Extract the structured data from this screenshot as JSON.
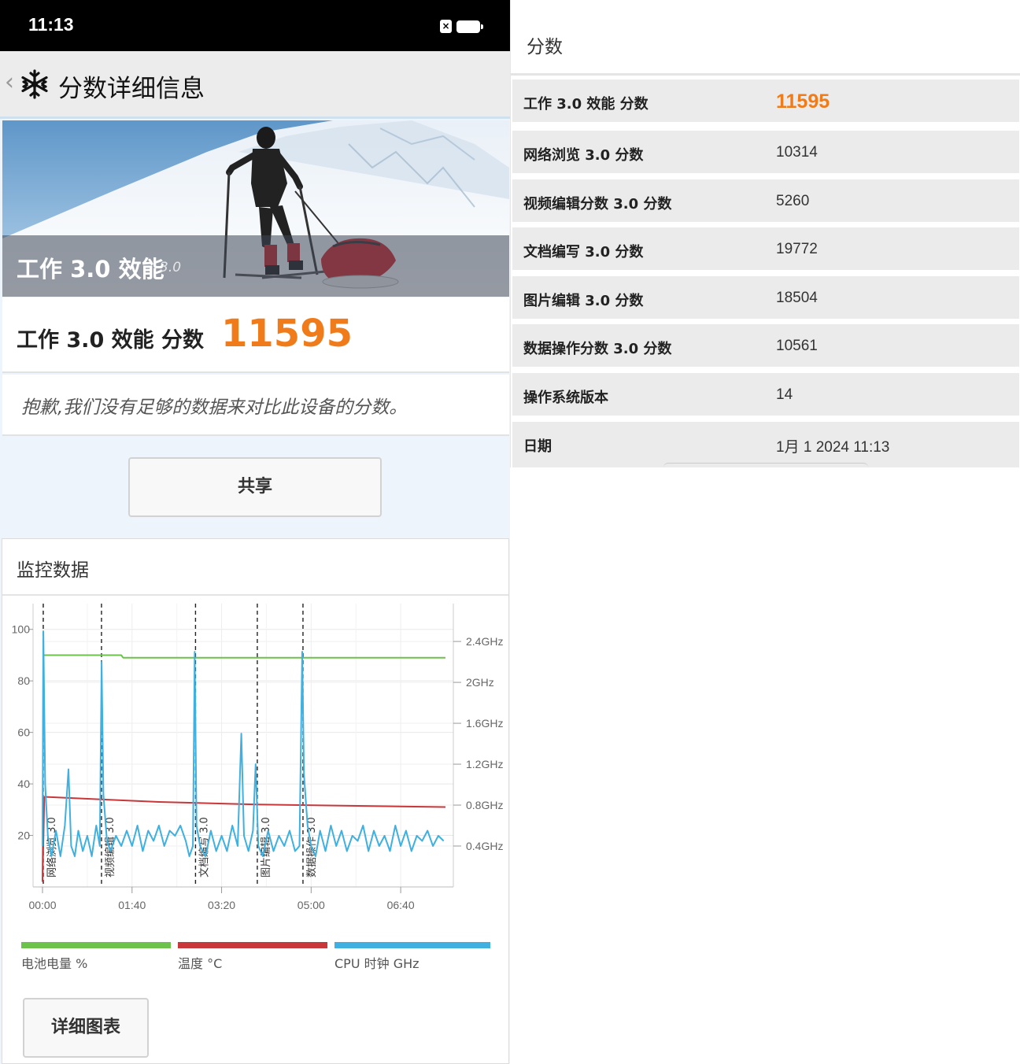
{
  "status_bar": {
    "time": "11:13",
    "sim_icon": "sim-x-icon",
    "battery_icon": "battery-icon"
  },
  "header": {
    "back_icon": "chevron-left-icon",
    "logo_icon": "snowflake-logo-icon",
    "title": "分数详细信息"
  },
  "banner": {
    "title": "工作 3.0 效能",
    "version": "3.0"
  },
  "score": {
    "label": "工作 3.0 效能 分数",
    "value": "11595",
    "accent_color": "#f07b1a"
  },
  "notice": "抱歉,我们没有足够的数据来对比此设备的分数。",
  "share_button": "共享",
  "monitor": {
    "title": "监控数据",
    "detail_button": "详细图表",
    "legend": [
      {
        "label": "电池电量 %",
        "color": "#6cc24a"
      },
      {
        "label": "温度 °C",
        "color": "#c8373a"
      },
      {
        "label": "CPU 时钟 GHz",
        "color": "#3fb0e0"
      }
    ]
  },
  "chart_data": {
    "type": "line",
    "x_tick_labels": [
      "00:00",
      "01:40",
      "03:20",
      "05:00",
      "06:40"
    ],
    "left_axis": {
      "ticks": [
        20,
        40,
        60,
        80,
        100
      ],
      "ylim": [
        0,
        110
      ]
    },
    "right_axis": {
      "ticks": [
        "0.4GHz",
        "0.8GHz",
        "1.2GHz",
        "1.6GHz",
        "2GHz",
        "2.4GHz"
      ],
      "ylim": [
        0,
        2.77
      ]
    },
    "xlim_seconds": [
      0,
      450
    ],
    "segment_markers": [
      {
        "label": "网络浏览 3.0",
        "t": 0
      },
      {
        "label": "视频编辑 3.0",
        "t": 65
      },
      {
        "label": "文档编写 3.0",
        "t": 170
      },
      {
        "label": "图片编辑 3.0",
        "t": 239
      },
      {
        "label": "数据操作 3.0",
        "t": 290
      }
    ],
    "series": [
      {
        "name": "电池电量 %",
        "axis": "left",
        "color": "#6cc24a",
        "points": [
          [
            0,
            2
          ],
          [
            1,
            90
          ],
          [
            88,
            90
          ],
          [
            90,
            89
          ],
          [
            450,
            89
          ]
        ]
      },
      {
        "name": "温度 °C",
        "axis": "left",
        "color": "#c8373a",
        "points": [
          [
            0,
            2
          ],
          [
            2,
            35
          ],
          [
            65,
            34
          ],
          [
            130,
            33
          ],
          [
            240,
            32
          ],
          [
            450,
            31
          ]
        ]
      },
      {
        "name": "CPU 时钟 GHz",
        "axis": "right",
        "color": "#3fb0e0",
        "points": [
          [
            0,
            0.4
          ],
          [
            1,
            2.5
          ],
          [
            3,
            1.0
          ],
          [
            6,
            0.5
          ],
          [
            10,
            0.3
          ],
          [
            15,
            0.55
          ],
          [
            20,
            0.3
          ],
          [
            25,
            0.6
          ],
          [
            29,
            1.15
          ],
          [
            32,
            0.4
          ],
          [
            36,
            0.3
          ],
          [
            40,
            0.55
          ],
          [
            45,
            0.35
          ],
          [
            50,
            0.5
          ],
          [
            55,
            0.3
          ],
          [
            60,
            0.6
          ],
          [
            64,
            0.4
          ],
          [
            66,
            2.2
          ],
          [
            68,
            0.9
          ],
          [
            72,
            0.45
          ],
          [
            76,
            0.35
          ],
          [
            82,
            0.5
          ],
          [
            88,
            0.4
          ],
          [
            94,
            0.55
          ],
          [
            100,
            0.4
          ],
          [
            106,
            0.6
          ],
          [
            112,
            0.35
          ],
          [
            118,
            0.55
          ],
          [
            124,
            0.45
          ],
          [
            130,
            0.6
          ],
          [
            136,
            0.4
          ],
          [
            142,
            0.55
          ],
          [
            148,
            0.5
          ],
          [
            154,
            0.6
          ],
          [
            160,
            0.45
          ],
          [
            164,
            0.3
          ],
          [
            168,
            0.4
          ],
          [
            170,
            2.3
          ],
          [
            172,
            0.6
          ],
          [
            176,
            0.4
          ],
          [
            182,
            0.3
          ],
          [
            188,
            0.55
          ],
          [
            194,
            0.35
          ],
          [
            200,
            0.5
          ],
          [
            206,
            0.35
          ],
          [
            212,
            0.6
          ],
          [
            218,
            0.4
          ],
          [
            222,
            1.5
          ],
          [
            225,
            0.5
          ],
          [
            230,
            0.35
          ],
          [
            235,
            0.55
          ],
          [
            238,
            1.2
          ],
          [
            241,
            0.4
          ],
          [
            246,
            0.3
          ],
          [
            252,
            0.55
          ],
          [
            258,
            0.35
          ],
          [
            264,
            0.5
          ],
          [
            270,
            0.4
          ],
          [
            276,
            0.55
          ],
          [
            282,
            0.35
          ],
          [
            287,
            0.4
          ],
          [
            290,
            2.3
          ],
          [
            292,
            1.1
          ],
          [
            296,
            0.6
          ],
          [
            300,
            0.4
          ],
          [
            305,
            0.3
          ],
          [
            310,
            0.55
          ],
          [
            316,
            0.35
          ],
          [
            322,
            0.6
          ],
          [
            328,
            0.4
          ],
          [
            334,
            0.55
          ],
          [
            340,
            0.35
          ],
          [
            346,
            0.5
          ],
          [
            352,
            0.45
          ],
          [
            358,
            0.6
          ],
          [
            364,
            0.35
          ],
          [
            370,
            0.55
          ],
          [
            376,
            0.4
          ],
          [
            382,
            0.5
          ],
          [
            388,
            0.35
          ],
          [
            394,
            0.6
          ],
          [
            400,
            0.4
          ],
          [
            406,
            0.55
          ],
          [
            412,
            0.35
          ],
          [
            418,
            0.5
          ],
          [
            424,
            0.45
          ],
          [
            430,
            0.55
          ],
          [
            436,
            0.4
          ],
          [
            442,
            0.5
          ],
          [
            448,
            0.45
          ]
        ]
      }
    ]
  },
  "details": {
    "title": "分数",
    "rows": [
      {
        "key": "工作 3.0 效能 分数",
        "value": "11595",
        "highlight": true
      },
      {
        "key": "网络浏览 3.0 分数",
        "value": "10314"
      },
      {
        "key": "视频编辑分数 3.0 分数",
        "value": "5260"
      },
      {
        "key": "文档编写 3.0 分数",
        "value": "19772"
      },
      {
        "key": "图片编辑 3.0 分数",
        "value": "18504"
      },
      {
        "key": "数据操作分数 3.0 分数",
        "value": "10561"
      },
      {
        "key": "操作系统版本",
        "value": "14"
      },
      {
        "key": "日期",
        "value": "1月 1 2024 11:13"
      }
    ]
  }
}
